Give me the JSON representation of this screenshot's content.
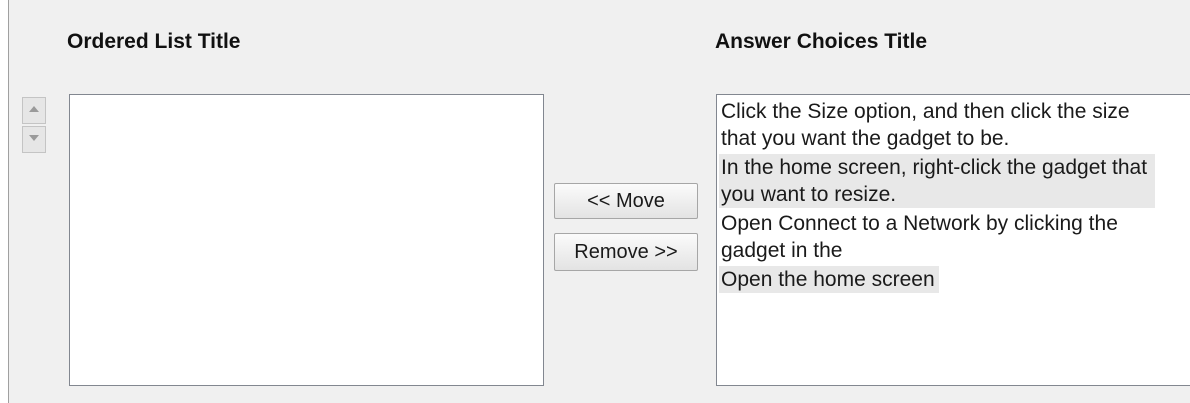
{
  "ordered_list": {
    "title": "Ordered List Title",
    "items": []
  },
  "answer_choices": {
    "title": "Answer Choices Title",
    "items": [
      "Click the Size option, and then click the size that you want the gadget to be.",
      "In the home screen, right-click the gadget that you want to resize.",
      "Open Connect to a Network by clicking the gadget in the",
      "Open the home screen"
    ]
  },
  "buttons": {
    "move": "<< Move",
    "remove": "Remove >>"
  },
  "icons": {
    "up": "arrow-up-icon",
    "down": "arrow-down-icon"
  }
}
